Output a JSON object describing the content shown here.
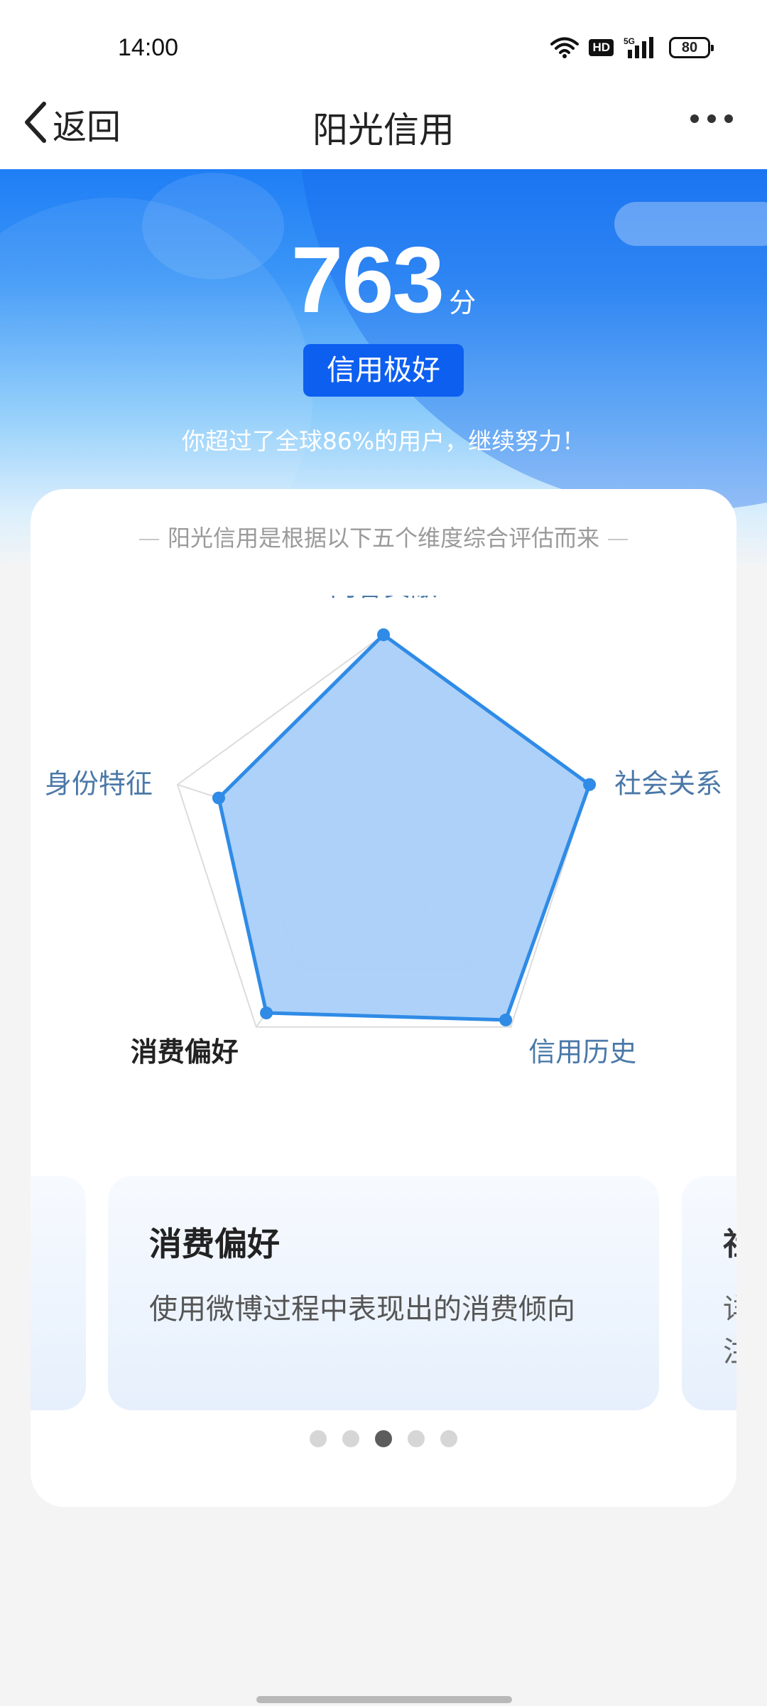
{
  "status_bar": {
    "time": "14:00",
    "network_badge": "HD",
    "signal_label": "5G",
    "battery": "80"
  },
  "nav": {
    "back_label": "返回",
    "title": "阳光信用"
  },
  "score": {
    "value": "763",
    "unit": "分",
    "level": "信用极好",
    "rank_note": "你超过了全球86%的用户，继续努力！"
  },
  "card": {
    "caption": "阳光信用是根据以下五个维度综合评估而来"
  },
  "radar": {
    "dimensions": [
      "内容贡献",
      "社会关系",
      "信用历史",
      "消费偏好",
      "身份特征"
    ],
    "values": [
      1.0,
      1.0,
      0.96,
      0.92,
      0.8
    ],
    "active_index": 3,
    "fill_color": "#a9cff9",
    "line_color": "#2f8be6"
  },
  "carousel": {
    "active_index": 2,
    "slides": [
      {
        "title": "消费偏好",
        "desc": "使用微博过程中表现出的消费倾向"
      }
    ],
    "right_fragment": {
      "line1": "社",
      "line2": "详",
      "line3": "注"
    }
  },
  "pagination": {
    "count": 5,
    "active": 2
  }
}
